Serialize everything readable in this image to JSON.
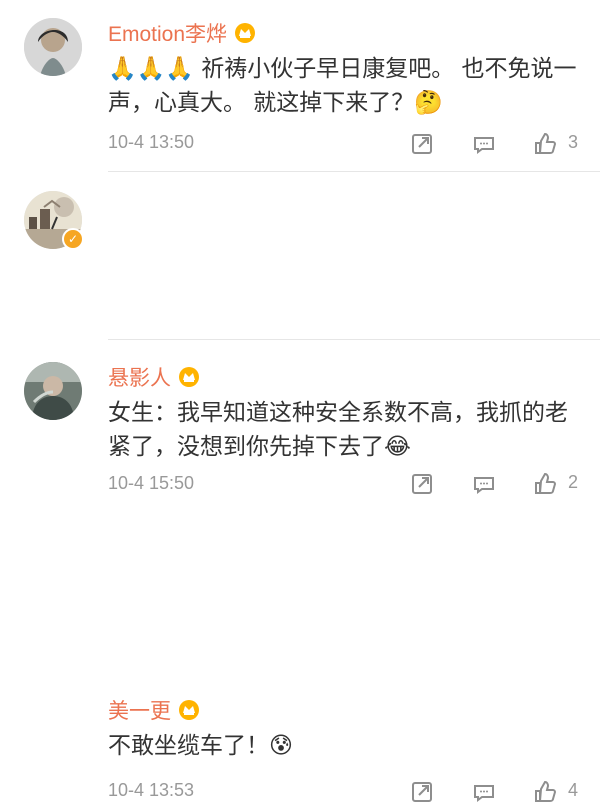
{
  "comments": [
    {
      "user": "Emotion李烨",
      "text": "🙏🙏🙏  祈祷小伙子早日康复吧。  也不免说一声，心真大。 就这掉下来了？🤔",
      "time": "10-4 13:50",
      "likes": "3"
    },
    {
      "user": "悬影人",
      "text": "女生：我早知道这种安全系数不高，我抓的老紧了，没想到你先掉下去了😂",
      "time": "10-4 15:50",
      "likes": "2"
    },
    {
      "user": "美一更",
      "text": "不敢坐缆车了！😰",
      "time": "10-4 13:53",
      "likes": "4"
    }
  ],
  "colors": {
    "username": "#eb7350",
    "text": "#333333",
    "meta": "#999999",
    "verified": "#f6a623"
  },
  "icons": {
    "crown": "crown-icon",
    "share": "share-icon",
    "reply": "comment-icon",
    "like": "like-icon",
    "verified": "verified-icon"
  }
}
